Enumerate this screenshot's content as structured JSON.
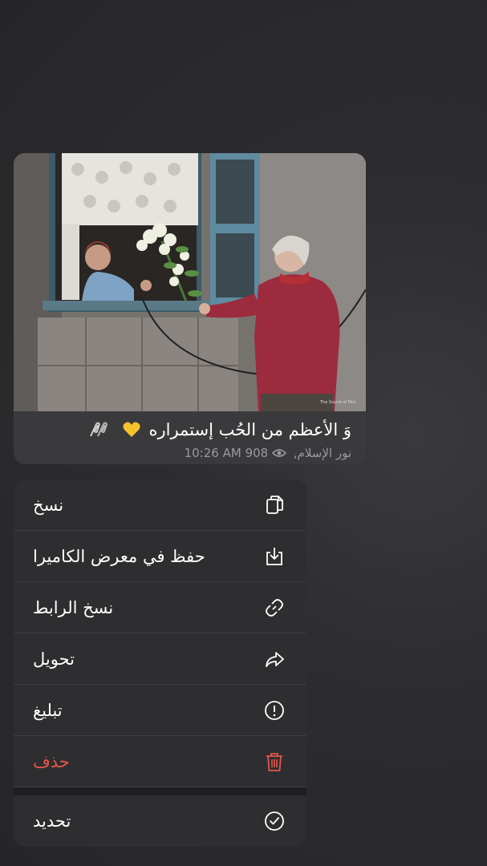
{
  "message": {
    "caption": "وَ الأعظم من الحُب إستمراره",
    "emoji_heart": "yellow-heart",
    "emoji_clip": "paperclips",
    "time": "10:26 AM",
    "author": "نور الإسلام,",
    "views": "908",
    "photo_watermark": "The Sound of Pics"
  },
  "menu": {
    "items": [
      {
        "label": "نسخ",
        "icon": "copy-icon"
      },
      {
        "label": "حفظ في معرض الكاميرا",
        "icon": "save-to-gallery-icon"
      },
      {
        "label": "نسخ الرابط",
        "icon": "link-icon"
      },
      {
        "label": "تحويل",
        "icon": "forward-icon"
      },
      {
        "label": "تبليغ",
        "icon": "report-icon"
      },
      {
        "label": "حذف",
        "icon": "trash-icon",
        "color": "#e5564a"
      }
    ],
    "select": {
      "label": "تحديد",
      "icon": "checkmark-circle-icon"
    }
  },
  "colors": {
    "background": "#2b2b2d",
    "bubble": "#3a3a3c",
    "menu": "#2e2e30",
    "danger": "#e5564a",
    "meta_text": "#9a9a9e"
  }
}
